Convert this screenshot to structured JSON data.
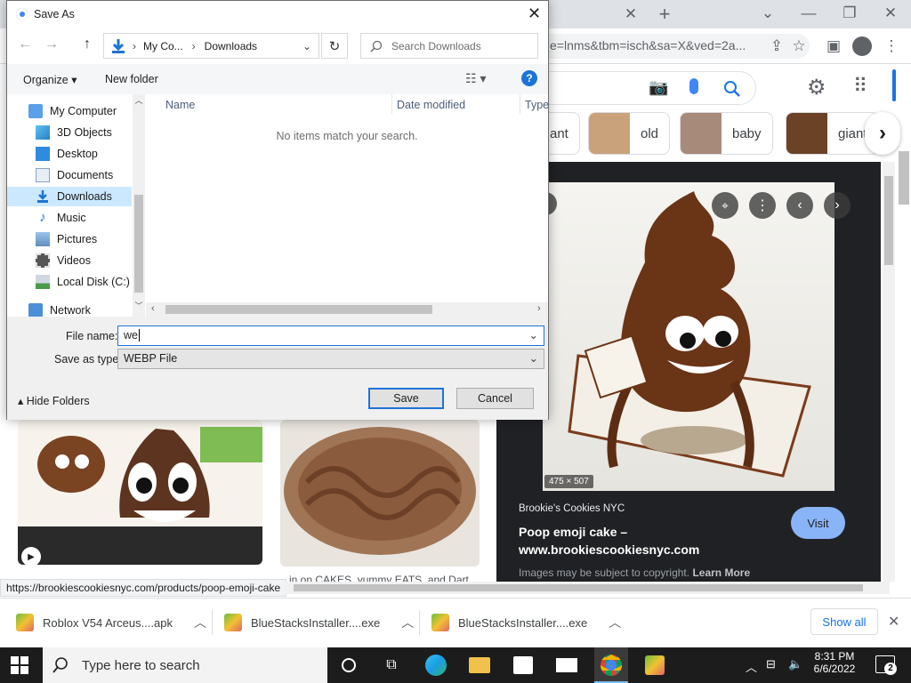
{
  "browser": {
    "url": "e=lnms&tbm=isch&sa=X&ved=2a...",
    "status_url": "https://brookiescookiesnyc.com/products/poop-emoji-cake",
    "chips": [
      {
        "label": "ant"
      },
      {
        "label": "old"
      },
      {
        "label": "baby"
      },
      {
        "label": "giant"
      }
    ],
    "preview": {
      "dimensions": "475 × 507",
      "source": "Brookie's Cookies NYC",
      "title_line1": "Poop emoji cake –",
      "title_line2": "www.brookiescookiesnyc.com",
      "copyright": "Images may be subject to copyright.",
      "learn_more": "Learn More",
      "visit_label": "Visit"
    },
    "result_caption": "in on CAKES, yummy EATS, and Dart..."
  },
  "dialog": {
    "title": "Save As",
    "breadcrumb": [
      "My Co...",
      "Downloads"
    ],
    "search_placeholder": "Search Downloads",
    "organize_label": "Organize",
    "new_folder_label": "New folder",
    "nav_items": [
      {
        "label": "My Computer",
        "icon": "computer-icon"
      },
      {
        "label": "3D Objects",
        "icon": "cube-icon"
      },
      {
        "label": "Desktop",
        "icon": "desktop-icon"
      },
      {
        "label": "Documents",
        "icon": "document-icon"
      },
      {
        "label": "Downloads",
        "icon": "download-icon"
      },
      {
        "label": "Music",
        "icon": "music-icon"
      },
      {
        "label": "Pictures",
        "icon": "pictures-icon"
      },
      {
        "label": "Videos",
        "icon": "video-icon"
      },
      {
        "label": "Local Disk (C:)",
        "icon": "disk-icon"
      },
      {
        "label": "Network",
        "icon": "network-icon"
      }
    ],
    "columns": [
      "Name",
      "Date modified",
      "Type"
    ],
    "empty_message": "No items match your search.",
    "file_name_label": "File name:",
    "file_name_value": "we",
    "save_type_label": "Save as type:",
    "save_type_value": "WEBP File",
    "hide_folders_label": "Hide Folders",
    "save_label": "Save",
    "cancel_label": "Cancel"
  },
  "downloads": {
    "items": [
      "Roblox V54 Arceus....apk",
      "BlueStacksInstaller....exe",
      "BlueStacksInstaller....exe"
    ],
    "show_all": "Show all"
  },
  "taskbar": {
    "search_placeholder": "Type here to search",
    "time": "8:31 PM",
    "date": "6/6/2022",
    "notifications": "2"
  },
  "colors": {
    "accent": "#1a73e8",
    "dialog_select": "#cce8ff",
    "taskbar": "#1c1c1c"
  }
}
